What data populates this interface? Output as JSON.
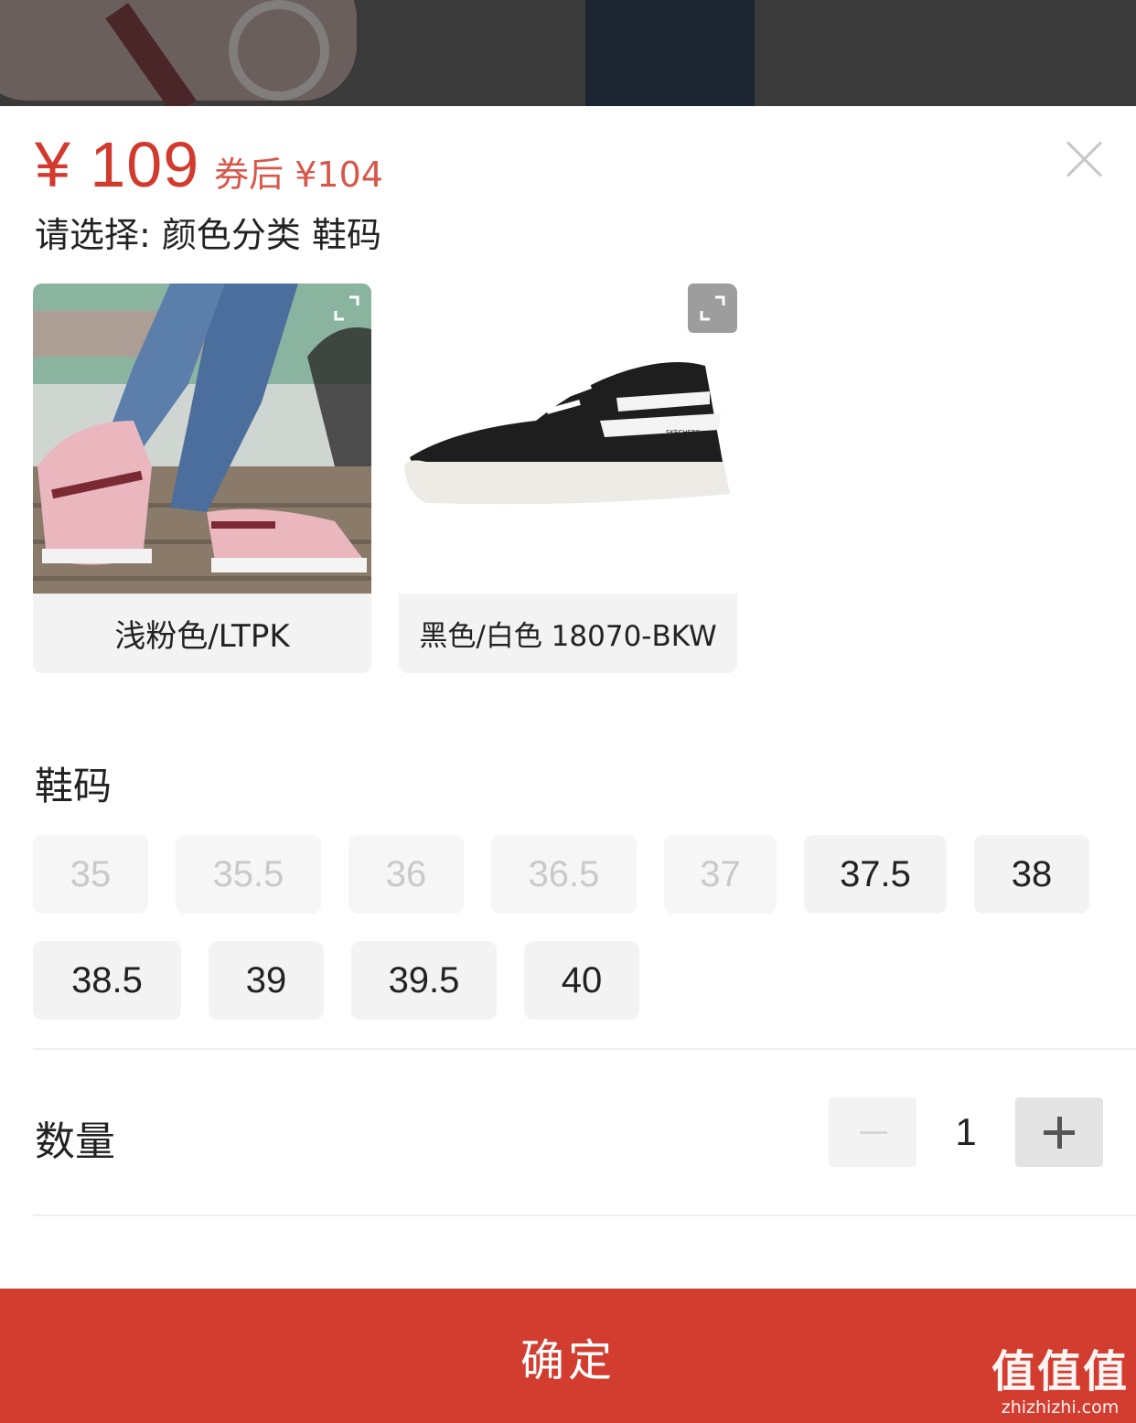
{
  "price": {
    "main": "¥ 109",
    "coupon": "券后 ¥104"
  },
  "select_prompt": "请选择: 颜色分类 鞋码",
  "colors": [
    {
      "label": "浅粉色/LTPK",
      "image": "pink-shoe-worn-photo",
      "icon": "expand-icon"
    },
    {
      "label": "黑色/白色 18070-BKW",
      "image": "black-white-high-top-sneaker",
      "icon": "expand-icon"
    }
  ],
  "sizes": {
    "title": "鞋码",
    "items": [
      {
        "label": "35",
        "available": false
      },
      {
        "label": "35.5",
        "available": false
      },
      {
        "label": "36",
        "available": false
      },
      {
        "label": "36.5",
        "available": false
      },
      {
        "label": "37",
        "available": false
      },
      {
        "label": "37.5",
        "available": true
      },
      {
        "label": "38",
        "available": true
      },
      {
        "label": "38.5",
        "available": true
      },
      {
        "label": "39",
        "available": true
      },
      {
        "label": "39.5",
        "available": true
      },
      {
        "label": "40",
        "available": true
      }
    ]
  },
  "quantity": {
    "title": "数量",
    "value": "1"
  },
  "confirm_label": "确定",
  "watermark": {
    "main": "值值值",
    "url": "zhizhizhi.com"
  },
  "colors_theme": {
    "accent": "#d23d30",
    "price": "#d23a2e"
  }
}
